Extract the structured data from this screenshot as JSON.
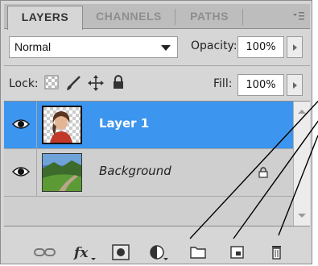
{
  "tabs": [
    {
      "label": "LAYERS",
      "active": true
    },
    {
      "label": "CHANNELS",
      "active": false
    },
    {
      "label": "PATHS",
      "active": false
    }
  ],
  "panel_menu_icon": "panel-menu-icon",
  "blend_mode": {
    "selected": "Normal"
  },
  "opacity": {
    "label": "Opacity:",
    "value": "100%"
  },
  "lock": {
    "label": "Lock:",
    "icons": [
      "lock-transparent-pixels-icon",
      "lock-image-pixels-icon",
      "lock-position-icon",
      "lock-all-icon"
    ]
  },
  "fill": {
    "label": "Fill:",
    "value": "100%"
  },
  "layers": [
    {
      "name": "Layer 1",
      "selected": true,
      "visible": true,
      "locked": false
    },
    {
      "name": "Background",
      "selected": false,
      "visible": true,
      "locked": true
    }
  ],
  "bottom_icons": [
    "link-layers-icon",
    "layer-style-fx-icon",
    "add-mask-icon",
    "adjustment-layer-icon",
    "new-group-icon",
    "new-layer-icon",
    "delete-layer-icon"
  ],
  "colors": {
    "selection": "#3c95ee",
    "panel": "#d6d6d6"
  }
}
